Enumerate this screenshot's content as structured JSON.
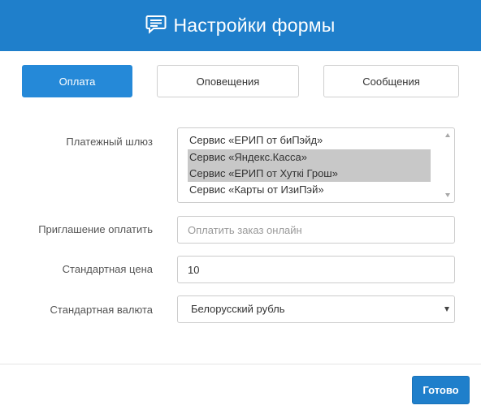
{
  "header": {
    "title": "Настройки формы",
    "icon": "message-icon"
  },
  "tabs": [
    {
      "label": "Оплата",
      "active": true
    },
    {
      "label": "Оповещения",
      "active": false
    },
    {
      "label": "Сообщения",
      "active": false
    }
  ],
  "form": {
    "gateway": {
      "label": "Платежный шлюз",
      "options": [
        {
          "text": "Сервис «ЕРИП от биПэйд»",
          "selected": false
        },
        {
          "text": "Сервис «Яндекс.Касса»",
          "selected": true
        },
        {
          "text": "Сервис «ЕРИП от Хуткі Грош»",
          "selected": true
        },
        {
          "text": "Сервис «Карты от ИзиПэй»",
          "selected": false
        }
      ]
    },
    "invite": {
      "label": "Приглашение оплатить",
      "value": "",
      "placeholder": "Оплатить заказ онлайн"
    },
    "price": {
      "label": "Стандартная цена",
      "value": "10"
    },
    "currency": {
      "label": "Стандартная валюта",
      "selected": "Белорусский рубль"
    }
  },
  "footer": {
    "done_label": "Готово"
  },
  "colors": {
    "header_bg": "#1f7fcb",
    "active_tab": "#2589d8",
    "selection": "#c8c8c8"
  }
}
